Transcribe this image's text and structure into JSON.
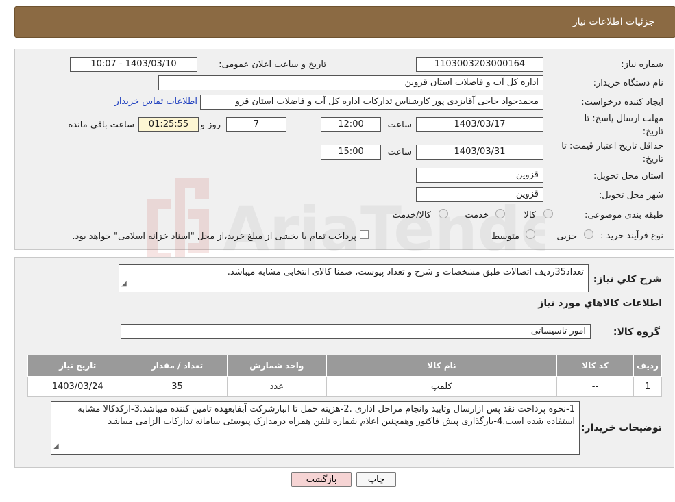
{
  "header": {
    "title": "جزئیات اطلاعات نیاز"
  },
  "need_info": {
    "need_number_label": "شماره نیاز:",
    "need_number": "1103003203000164",
    "announce_label": "تاریخ و ساعت اعلان عمومی:",
    "announce_value": "1403/03/10 - 10:07",
    "buyer_label": "نام دستگاه خریدار:",
    "buyer_value": "اداره کل آب و فاضلاب استان قزوین",
    "creator_label": "ایجاد کننده درخواست:",
    "creator_value": "محمدجواد حاجی آقایزدی پور کارشناس تدارکات اداره کل آب و فاضلاب استان قزو",
    "contact_link": "اطلاعات تماس خریدار",
    "deadline_label_1": "مهلت ارسال پاسخ: تا",
    "deadline_label_2": "تاریخ:",
    "deadline_date": "1403/03/17",
    "time_label": "ساعت",
    "deadline_time": "12:00",
    "days_value": "7",
    "days_label": "روز و",
    "remaining_time": "01:25:55",
    "remaining_label": "ساعت باقی مانده",
    "validity_label_1": "حداقل تاریخ اعتبار قیمت: تا",
    "validity_label_2": "تاریخ:",
    "validity_date": "1403/03/31",
    "validity_time": "15:00",
    "province_label": "استان محل تحویل:",
    "province_value": "قزوین",
    "city_label": "شهر محل تحویل:",
    "city_value": "قزوین",
    "category_label": "طبقه بندی موضوعی:",
    "category_options": [
      "کالا",
      "خدمت",
      "کالا/خدمت"
    ],
    "process_label": "نوع فرآیند خرید :",
    "process_options": [
      "جزیی",
      "متوسط"
    ],
    "process_note": "پرداخت تمام یا بخشی از مبلغ خرید،از محل \"اسناد خزانه اسلامی\" خواهد بود."
  },
  "description": {
    "label": "شرح كلي نياز:",
    "value": "تعداد35ردیف اتصالات طبق مشخصات و شرح و تعداد پیوست، ضمنا کالای انتخابی مشابه میباشد."
  },
  "goods": {
    "section_title": "اطلاعات كالاهاي مورد نياز",
    "group_label": "گروه کالا:",
    "group_value": "امور تاسیساتی",
    "table": {
      "headers": [
        "ردیف",
        "کد کالا",
        "نام کالا",
        "واحد شمارش",
        "تعداد / مقدار",
        "تاریخ نیاز"
      ],
      "rows": [
        [
          "1",
          "--",
          "کلمپ",
          "عدد",
          "35",
          "1403/03/24"
        ]
      ]
    }
  },
  "buyer_notes": {
    "label": "توضیحات خریدار:",
    "value": "1-نحوه پرداخت نقد پس ازارسال وتایید وانجام مراحل اداری .2-هزینه حمل تا انبارشرکت آبفابعهده تامین کننده میباشد.3-ازکدکالا مشابه استفاده شده است.4-بارگذاری پیش فاکتور وهمچنین اعلام شماره تلفن همراه درمدارک پیوستی سامانه تدارکات الزامی میباشد"
  },
  "buttons": {
    "print": "چاپ",
    "back": "بازگشت"
  },
  "watermark": {
    "text": "AriaTender.neT",
    "color": "#c23b33"
  },
  "colors": {
    "header_bg": "#8b6a43",
    "table_header_bg": "#9a9a9a",
    "back_button_bg": "#f6d4d4",
    "link": "#1f3fbf"
  }
}
